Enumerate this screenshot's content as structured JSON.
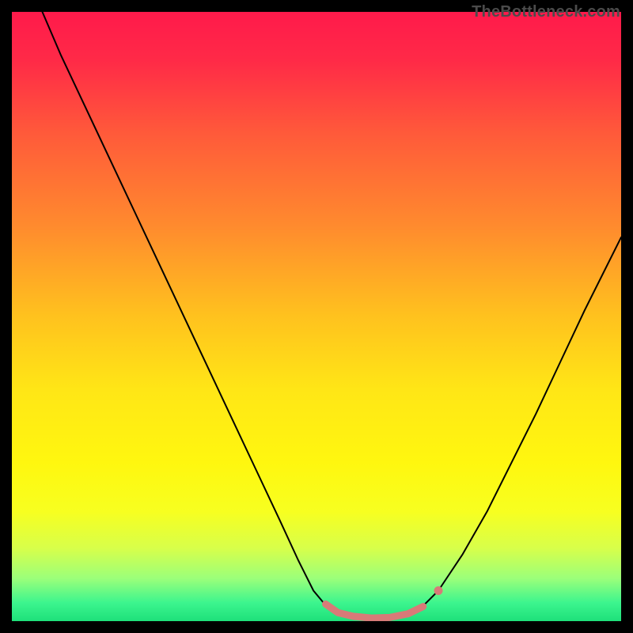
{
  "watermark": "TheBottleneck.com",
  "chart_data": {
    "type": "line",
    "title": "",
    "xlabel": "",
    "ylabel": "",
    "xlim": [
      0,
      100
    ],
    "ylim": [
      0,
      100
    ],
    "gradient_stops": [
      {
        "offset": 0.0,
        "color": "#ff1a4b"
      },
      {
        "offset": 0.08,
        "color": "#ff2a47"
      },
      {
        "offset": 0.2,
        "color": "#ff5a3a"
      },
      {
        "offset": 0.35,
        "color": "#ff8a2e"
      },
      {
        "offset": 0.5,
        "color": "#ffc21e"
      },
      {
        "offset": 0.62,
        "color": "#ffe616"
      },
      {
        "offset": 0.74,
        "color": "#fff70f"
      },
      {
        "offset": 0.82,
        "color": "#f7ff20"
      },
      {
        "offset": 0.88,
        "color": "#d8ff4a"
      },
      {
        "offset": 0.93,
        "color": "#9bff7a"
      },
      {
        "offset": 0.97,
        "color": "#3cf58e"
      },
      {
        "offset": 1.0,
        "color": "#1ee07a"
      }
    ],
    "series": [
      {
        "name": "bottleneck-curve",
        "stroke": "#000000",
        "stroke_width": 2.0,
        "points": [
          {
            "x": 5.0,
            "y": 100.0
          },
          {
            "x": 8.0,
            "y": 93.0
          },
          {
            "x": 12.0,
            "y": 84.5
          },
          {
            "x": 16.0,
            "y": 76.0
          },
          {
            "x": 20.0,
            "y": 67.5
          },
          {
            "x": 24.0,
            "y": 59.0
          },
          {
            "x": 28.0,
            "y": 50.5
          },
          {
            "x": 32.0,
            "y": 42.0
          },
          {
            "x": 36.0,
            "y": 33.5
          },
          {
            "x": 40.0,
            "y": 25.0
          },
          {
            "x": 44.0,
            "y": 16.5
          },
          {
            "x": 47.0,
            "y": 10.0
          },
          {
            "x": 49.5,
            "y": 5.0
          },
          {
            "x": 52.0,
            "y": 2.0
          },
          {
            "x": 55.0,
            "y": 0.7
          },
          {
            "x": 58.0,
            "y": 0.3
          },
          {
            "x": 61.0,
            "y": 0.3
          },
          {
            "x": 64.0,
            "y": 0.7
          },
          {
            "x": 67.0,
            "y": 2.0
          },
          {
            "x": 70.0,
            "y": 5.0
          },
          {
            "x": 74.0,
            "y": 11.0
          },
          {
            "x": 78.0,
            "y": 18.0
          },
          {
            "x": 82.0,
            "y": 26.0
          },
          {
            "x": 86.0,
            "y": 34.0
          },
          {
            "x": 90.0,
            "y": 42.5
          },
          {
            "x": 94.0,
            "y": 51.0
          },
          {
            "x": 98.0,
            "y": 59.0
          },
          {
            "x": 100.0,
            "y": 63.0
          }
        ]
      },
      {
        "name": "highlight-band",
        "stroke": "#d87a78",
        "stroke_width": 9.0,
        "linecap": "round",
        "points": [
          {
            "x": 51.5,
            "y": 2.8
          },
          {
            "x": 53.5,
            "y": 1.4
          },
          {
            "x": 56.0,
            "y": 0.8
          },
          {
            "x": 59.0,
            "y": 0.5
          },
          {
            "x": 62.0,
            "y": 0.6
          },
          {
            "x": 65.0,
            "y": 1.2
          },
          {
            "x": 67.5,
            "y": 2.4
          }
        ]
      }
    ],
    "markers": [
      {
        "name": "highlight-dot",
        "x": 70.0,
        "y": 5.0,
        "r": 5.5,
        "fill": "#d87a78"
      }
    ]
  }
}
